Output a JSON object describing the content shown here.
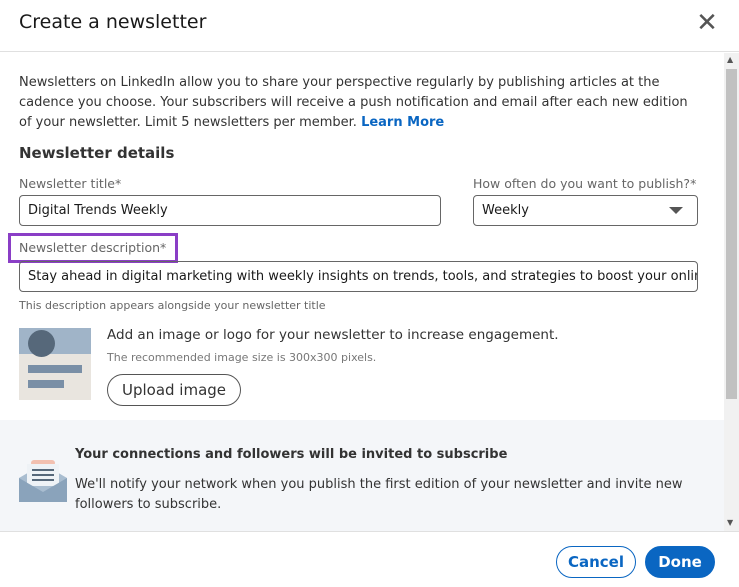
{
  "dialog": {
    "title": "Create a newsletter",
    "close_icon": "close-icon"
  },
  "intro": {
    "text": "Newsletters on LinkedIn allow you to share your perspective regularly by publishing articles at the cadence you choose. Your subscribers will receive a push notification and email after each new edition of your newsletter. Limit 5 newsletters per member. ",
    "link": "Learn More"
  },
  "details": {
    "heading": "Newsletter details",
    "title_label": "Newsletter title*",
    "title_value": "Digital Trends Weekly",
    "frequency_label": "How often do you want to publish?*",
    "frequency_value": "Weekly",
    "description_label": "Newsletter description*",
    "description_value": "Stay ahead in digital marketing with weekly insights on trends, tools, and strategies to boost your online suc",
    "description_hint": "This description appears alongside your newsletter title"
  },
  "image": {
    "prompt": "Add an image or logo for your newsletter to increase engagement.",
    "recommendation": "The recommended image size is 300x300 pixels.",
    "upload_label": "Upload image"
  },
  "info": {
    "heading": "Your connections and followers will be invited to subscribe",
    "body": "We'll notify your network when you publish the first edition of your newsletter and invite new followers to subscribe.",
    "icon": "envelope-icon"
  },
  "footer": {
    "cancel": "Cancel",
    "done": "Done"
  },
  "colors": {
    "accent": "#0a66c2",
    "highlight": "#8a3ec6"
  }
}
